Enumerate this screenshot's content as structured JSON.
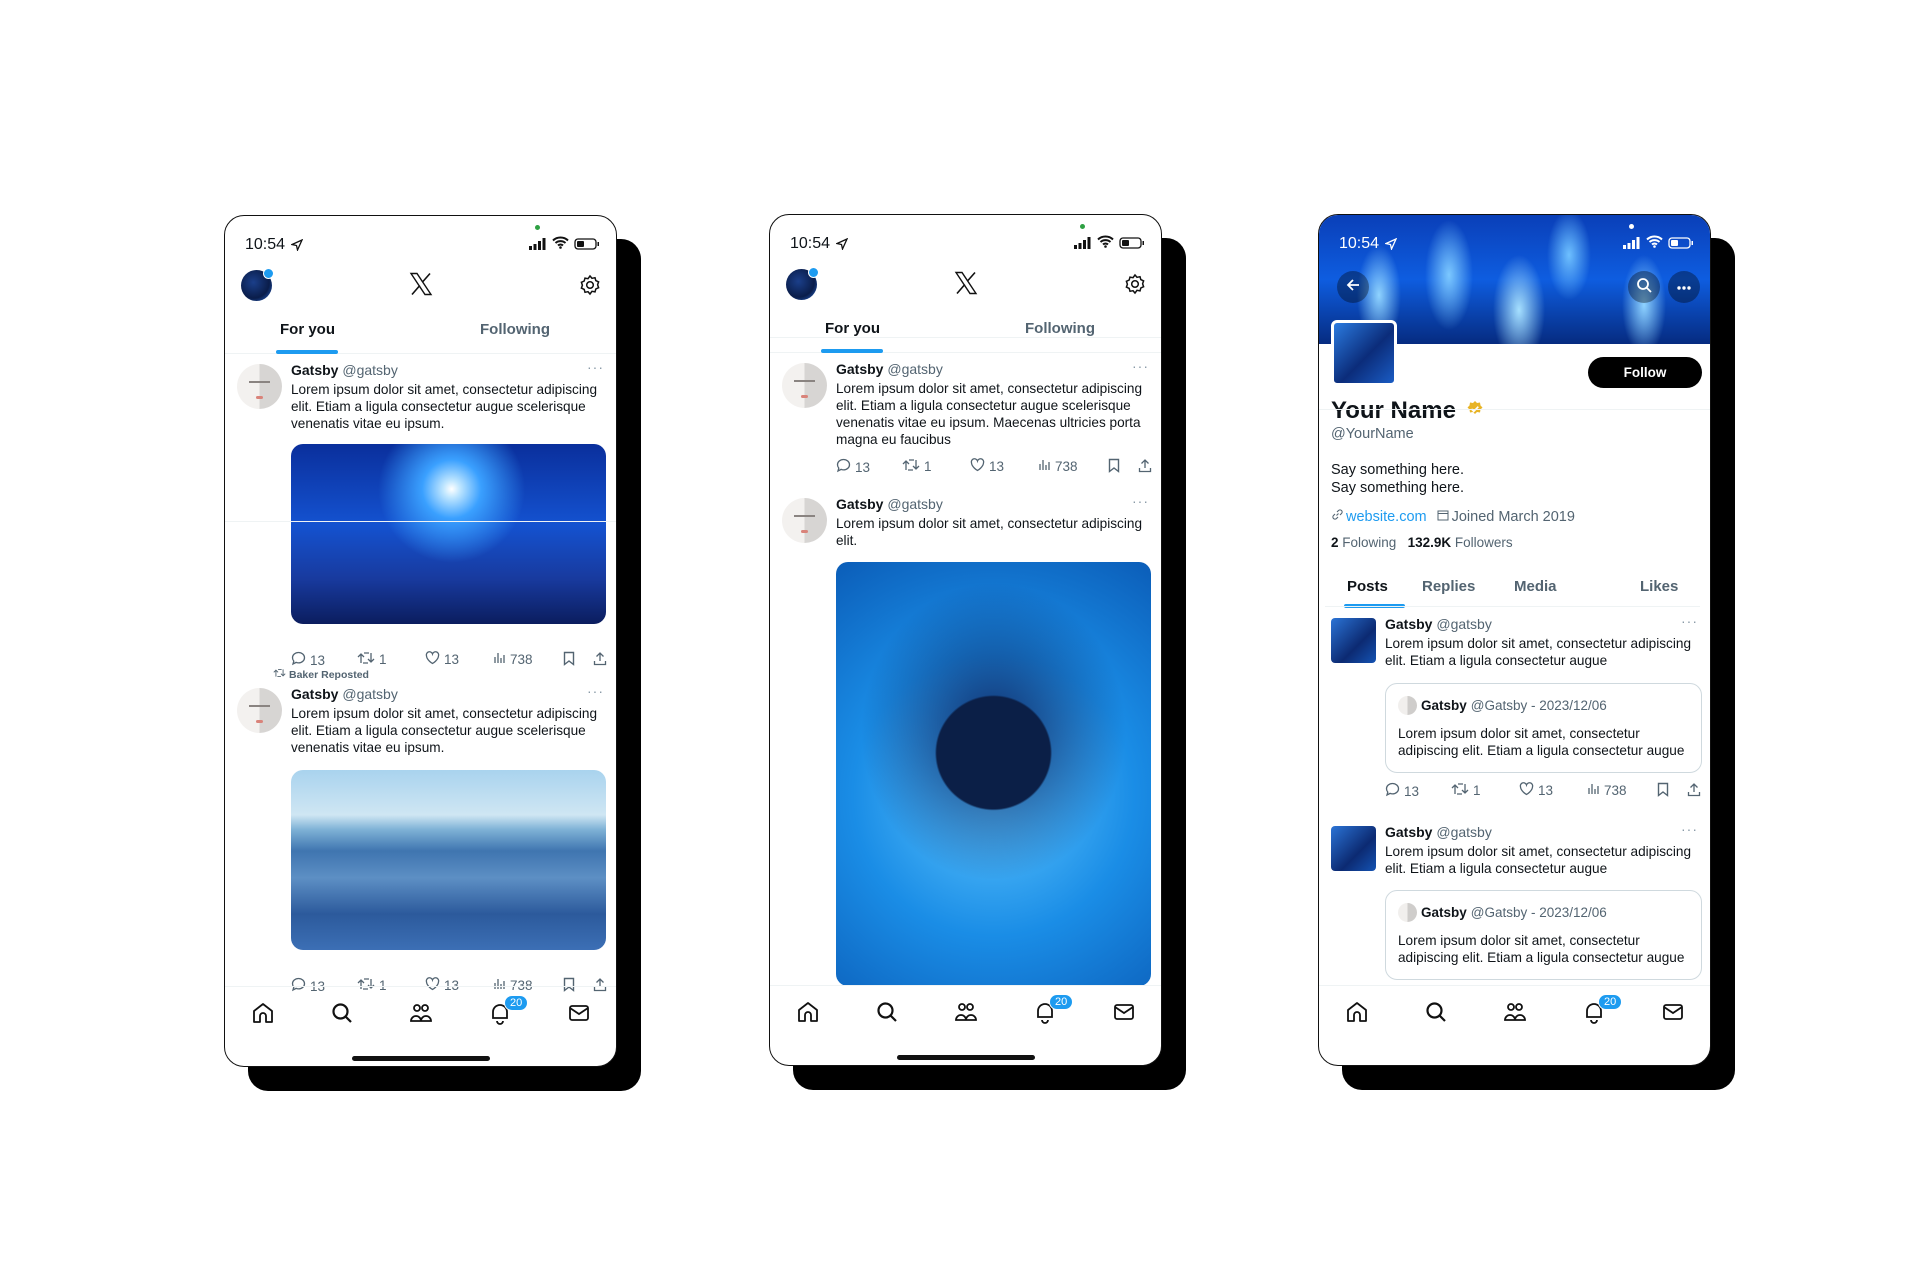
{
  "status": {
    "time": "10:54"
  },
  "feed_tabs": {
    "for_you": "For you",
    "following": "Following"
  },
  "notification_badge": "20",
  "colors": {
    "accent": "#1d9bf0",
    "text": "#0f1419",
    "muted": "#536471",
    "verified": "#e8b426"
  },
  "home_1": {
    "tweets": [
      {
        "name": "Gatsby",
        "handle": "@gatsby",
        "more": "···",
        "text": "Lorem ipsum dolor sit amet, consectetur adipiscing elit. Etiam a ligula consectetur augue scelerisque venenatis vitae eu ipsum.",
        "image": "power-lines-under-blue-sun",
        "replies": "13",
        "reposts": "1",
        "likes": "13",
        "views": "738"
      },
      {
        "repost_label": "Baker Reposted",
        "name": "Gatsby",
        "handle": "@gatsby",
        "more": "···",
        "text": "Lorem ipsum dolor sit amet, consectetur adipiscing elit. Etiam a ligula consectetur augue scelerisque venenatis vitae eu ipsum.",
        "image": "blue-river-landscape",
        "replies": "13",
        "reposts": "1",
        "likes": "13",
        "views": "738"
      }
    ]
  },
  "home_2": {
    "tweets": [
      {
        "name": "Gatsby",
        "handle": "@gatsby",
        "more": "···",
        "text": "Lorem ipsum dolor sit amet, consectetur adipiscing elit. Etiam a ligula consectetur augue scelerisque venenatis vitae eu ipsum. Maecenas ultricies porta magna eu faucibus",
        "replies": "13",
        "reposts": "1",
        "likes": "13",
        "views": "738"
      },
      {
        "name": "Gatsby",
        "handle": "@gatsby",
        "more": "···",
        "text": "Lorem ipsum dolor sit amet, consectetur adipiscing elit.",
        "image": "woman-with-flowing-hair-blue"
      }
    ]
  },
  "profile": {
    "follow_label": "Follow",
    "name": "Your Name",
    "handle": "@YourName",
    "bio_line1": "Say something here.",
    "bio_line2": "Say something here.",
    "website": "website.com",
    "joined": "Joined March 2019",
    "following_count": "2",
    "following_label": "Folowing",
    "followers_count": "132.9K",
    "followers_label": "Followers",
    "tabs": {
      "posts": "Posts",
      "replies": "Replies",
      "media": "Media",
      "likes": "Likes"
    },
    "tweets": [
      {
        "name": "Gatsby",
        "handle": "@gatsby",
        "more": "···",
        "text": "Lorem ipsum dolor sit amet, consectetur adipiscing elit. Etiam a ligula consectetur augue",
        "quote": {
          "name": "Gatsby",
          "meta": "@Gatsby - 2023/12/06",
          "text": "Lorem ipsum dolor sit amet, consectetur adipiscing elit. Etiam a ligula consectetur augue"
        },
        "replies": "13",
        "reposts": "1",
        "likes": "13",
        "views": "738"
      },
      {
        "name": "Gatsby",
        "handle": "@gatsby",
        "more": "···",
        "text": "Lorem ipsum dolor sit amet, consectetur adipiscing elit. Etiam a ligula consectetur augue",
        "quote": {
          "name": "Gatsby",
          "meta": "@Gatsby - 2023/12/06",
          "text": "Lorem ipsum dolor sit amet, consectetur adipiscing elit. Etiam a ligula consectetur augue"
        }
      }
    ]
  }
}
